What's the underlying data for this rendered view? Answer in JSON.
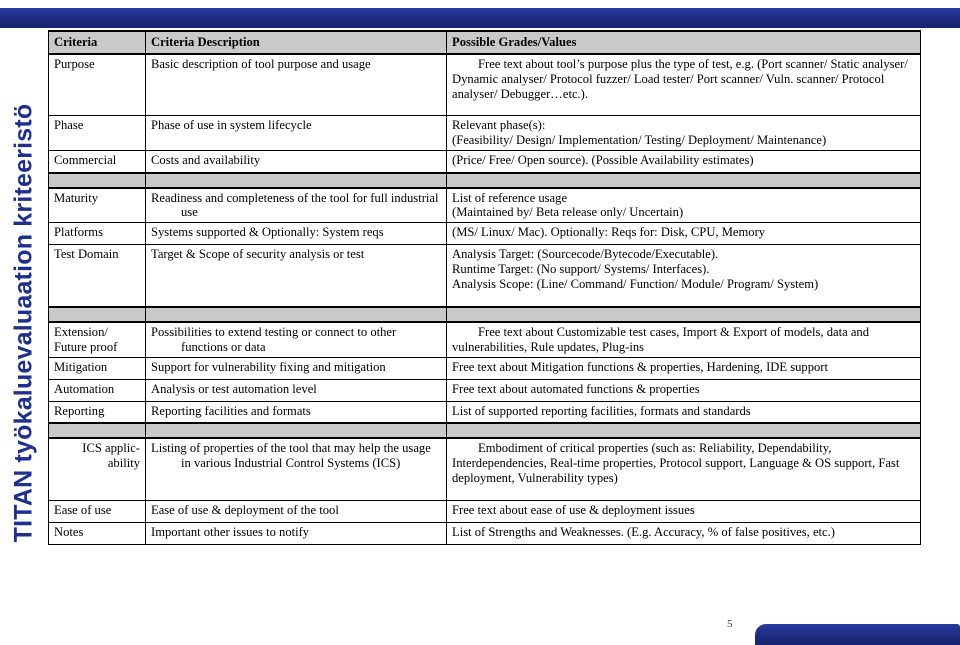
{
  "slide": {
    "side_title": "TITAN työkaluevaluaation kriteeristö",
    "page_number": "5",
    "accent_color": "#1e2f8c",
    "header_fill": "#c9c9c9"
  },
  "table": {
    "headers": {
      "criteria": "Criteria",
      "description": "Criteria Description",
      "values": "Possible Grades/Values"
    },
    "groups": [
      {
        "rows": [
          {
            "criteria": "Purpose",
            "description": "Basic description of tool purpose and usage",
            "values_lines": [
              "Free text about tool’s purpose plus the type of test, e.g. (Port scanner/ Static analyser/ Dynamic analyser/ Protocol fuzzer/ Load tester/ Port scanner/ Vuln. scanner/ Protocol analyser/ Debugger…etc.)."
            ]
          },
          {
            "criteria": "Phase",
            "description": "Phase of use in system lifecycle",
            "values_lines": [
              "Relevant phase(s):",
              "(Feasibility/ Design/ Implementation/ Testing/ Deployment/ Maintenance)"
            ]
          },
          {
            "criteria": "Commercial",
            "description": "Costs and availability",
            "values_lines": [
              "(Price/ Free/ Open source). (Possible Availability estimates)"
            ]
          }
        ]
      },
      {
        "rows": [
          {
            "criteria": "Maturity",
            "description": "Readiness and completeness of the tool for full industrial use",
            "values_lines": [
              "List of reference usage",
              "(Maintained by/ Beta release only/ Uncertain)"
            ]
          },
          {
            "criteria": "Platforms",
            "description": "Systems supported & Optionally: System reqs",
            "values_lines": [
              "(MS/ Linux/ Mac). Optionally: Reqs for: Disk, CPU, Memory"
            ]
          },
          {
            "criteria": "Test Domain",
            "description": "Target & Scope of security analysis or test",
            "values_lines": [
              "Analysis Target: (Sourcecode/Bytecode/Executable).",
              "Runtime Target: (No support/ Systems/ Interfaces).",
              "Analysis Scope: (Line/ Command/ Function/ Module/ Program/ System)"
            ]
          }
        ]
      },
      {
        "rows": [
          {
            "criteria": "Extension/ Future proof",
            "description": "Possibilities to extend testing or connect to other functions or data",
            "values_lines": [
              "Free text about Customizable test cases, Import & Export of models, data and vulnerabilities, Rule updates, Plug-ins"
            ]
          },
          {
            "criteria": "Mitigation",
            "description": "Support for vulnerability fixing and mitigation",
            "values_lines": [
              "Free text about Mitigation functions & properties, Hardening, IDE support"
            ]
          },
          {
            "criteria": "Automation",
            "description": "Analysis or test automation level",
            "values_lines": [
              "Free text about automated functions & properties"
            ]
          },
          {
            "criteria": "Reporting",
            "description": "Reporting facilities and formats",
            "values_lines": [
              "List of supported reporting facilities, formats and standards"
            ]
          }
        ]
      },
      {
        "rows": [
          {
            "criteria": "ICS applic- ability",
            "description": "Listing of properties of the tool that may help the usage in various Industrial Control Systems (ICS)",
            "values_lines": [
              "Embodiment of critical properties (such as: Reliability, Dependability, Interdependencies, Real-time properties, Protocol support, Language & OS support, Fast deployment, Vulnerability types)"
            ]
          },
          {
            "criteria": "Ease of use",
            "description": "Ease of use & deployment of the tool",
            "values_lines": [
              "Free text about ease of use & deployment issues"
            ]
          },
          {
            "criteria": "Notes",
            "description": "Important other issues to notify",
            "values_lines": [
              "List of Strengths and Weaknesses. (E.g. Accuracy, % of false positives, etc.)"
            ]
          }
        ]
      }
    ]
  }
}
